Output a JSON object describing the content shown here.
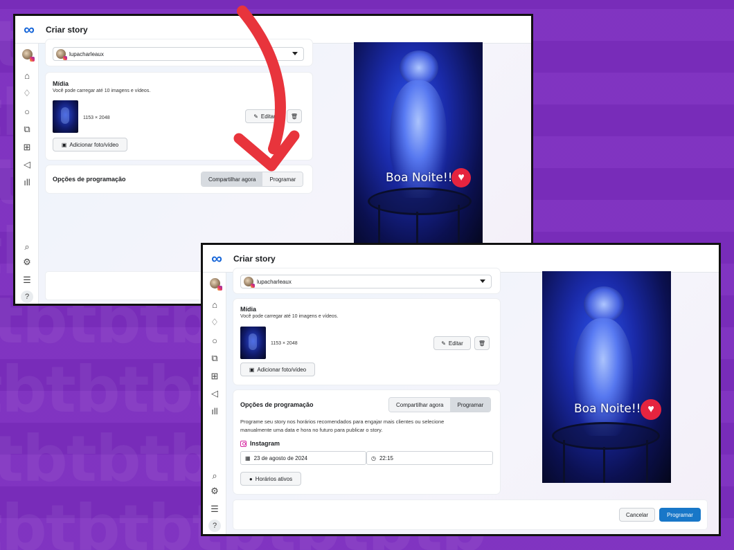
{
  "window1": {
    "title": "Criar story",
    "account": "lupacharleaux",
    "media": {
      "heading": "Mídia",
      "description": "Você pode carregar até 10 imagens e vídeos.",
      "dimensions": "1153 × 2048",
      "edit_label": "Editar",
      "add_label": "Adicionar foto/vídeo"
    },
    "scheduling": {
      "heading": "Opções de programação",
      "share_now": "Compartilhar agora",
      "schedule": "Programar",
      "active": "share_now"
    },
    "preview_text": "Boa Noite!!"
  },
  "window2": {
    "title": "Criar story",
    "account": "lupacharleaux",
    "media": {
      "heading": "Mídia",
      "description": "Você pode carregar até 10 imagens e vídeos.",
      "dimensions": "1153 × 2048",
      "edit_label": "Editar",
      "add_label": "Adicionar foto/vídeo"
    },
    "scheduling": {
      "heading": "Opções de programação",
      "share_now": "Compartilhar agora",
      "schedule": "Programar",
      "active": "schedule",
      "description": "Programe seu story nos horários recomendados para engajar mais clientes ou selecione manualmente uma data e hora no futuro para publicar o story.",
      "platform": "Instagram",
      "date": "23 de agosto de 2024",
      "time": "22:15",
      "active_times_label": "Horários ativos"
    },
    "preview_text": "Boa Noite!!",
    "footer": {
      "cancel_label": "Cancelar",
      "submit_label": "Programar"
    }
  },
  "icons": {
    "brand": "meta-logo",
    "rail": [
      "avatar",
      "home-icon",
      "bell-icon",
      "chat-icon",
      "posts-icon",
      "grid-icon",
      "megaphone-icon",
      "insights-icon",
      "search-icon",
      "settings-icon",
      "list-icon",
      "help-icon"
    ]
  },
  "colors": {
    "background": "#7c2dbf",
    "arrow": "#e8343c",
    "primary": "#1877c8",
    "heart": "#e5243f"
  }
}
